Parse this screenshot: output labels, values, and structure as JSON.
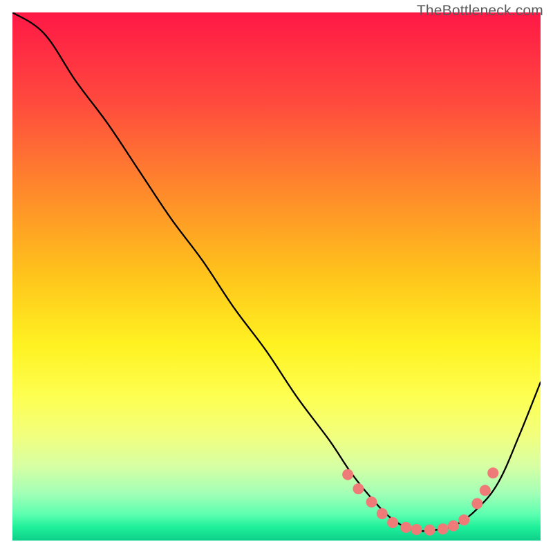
{
  "watermark": "TheBottleneck.com",
  "chart_data": {
    "type": "line",
    "title": "",
    "xlabel": "",
    "ylabel": "",
    "xlim": [
      0,
      100
    ],
    "ylim": [
      0,
      100
    ],
    "grid": false,
    "legend": false,
    "series": [
      {
        "name": "curve",
        "x": [
          0,
          6,
          12,
          18,
          24,
          30,
          36,
          42,
          48,
          54,
          60,
          64,
          68,
          72,
          76,
          80,
          84,
          88,
          92,
          96,
          100
        ],
        "y": [
          100,
          96,
          87,
          79,
          70,
          61,
          53,
          44,
          36,
          27,
          19,
          13,
          8,
          4,
          2,
          2,
          3,
          6,
          11,
          20,
          30
        ]
      }
    ],
    "highlight_points": {
      "name": "dots",
      "color": "#ef7b78",
      "radius_px": 8,
      "x": [
        63.5,
        65.5,
        68,
        70,
        72,
        74.5,
        76.5,
        79,
        81.5,
        83.5,
        85.5,
        88,
        89.5,
        91
      ],
      "y": [
        12.5,
        9.8,
        7.3,
        5.1,
        3.4,
        2.5,
        2.1,
        2.0,
        2.2,
        2.8,
        3.9,
        7.0,
        9.5,
        12.8
      ]
    },
    "background_gradient": {
      "stops": [
        {
          "offset": 0.0,
          "color": "#ff1846"
        },
        {
          "offset": 0.17,
          "color": "#ff4a3e"
        },
        {
          "offset": 0.34,
          "color": "#ff8a2b"
        },
        {
          "offset": 0.5,
          "color": "#ffc51b"
        },
        {
          "offset": 0.63,
          "color": "#fff222"
        },
        {
          "offset": 0.73,
          "color": "#fdff52"
        },
        {
          "offset": 0.8,
          "color": "#f2ff7d"
        },
        {
          "offset": 0.86,
          "color": "#d6ffa4"
        },
        {
          "offset": 0.91,
          "color": "#a3ffb6"
        },
        {
          "offset": 0.95,
          "color": "#5dffb0"
        },
        {
          "offset": 0.975,
          "color": "#1ef09a"
        },
        {
          "offset": 1.0,
          "color": "#0ecf89"
        }
      ]
    }
  }
}
